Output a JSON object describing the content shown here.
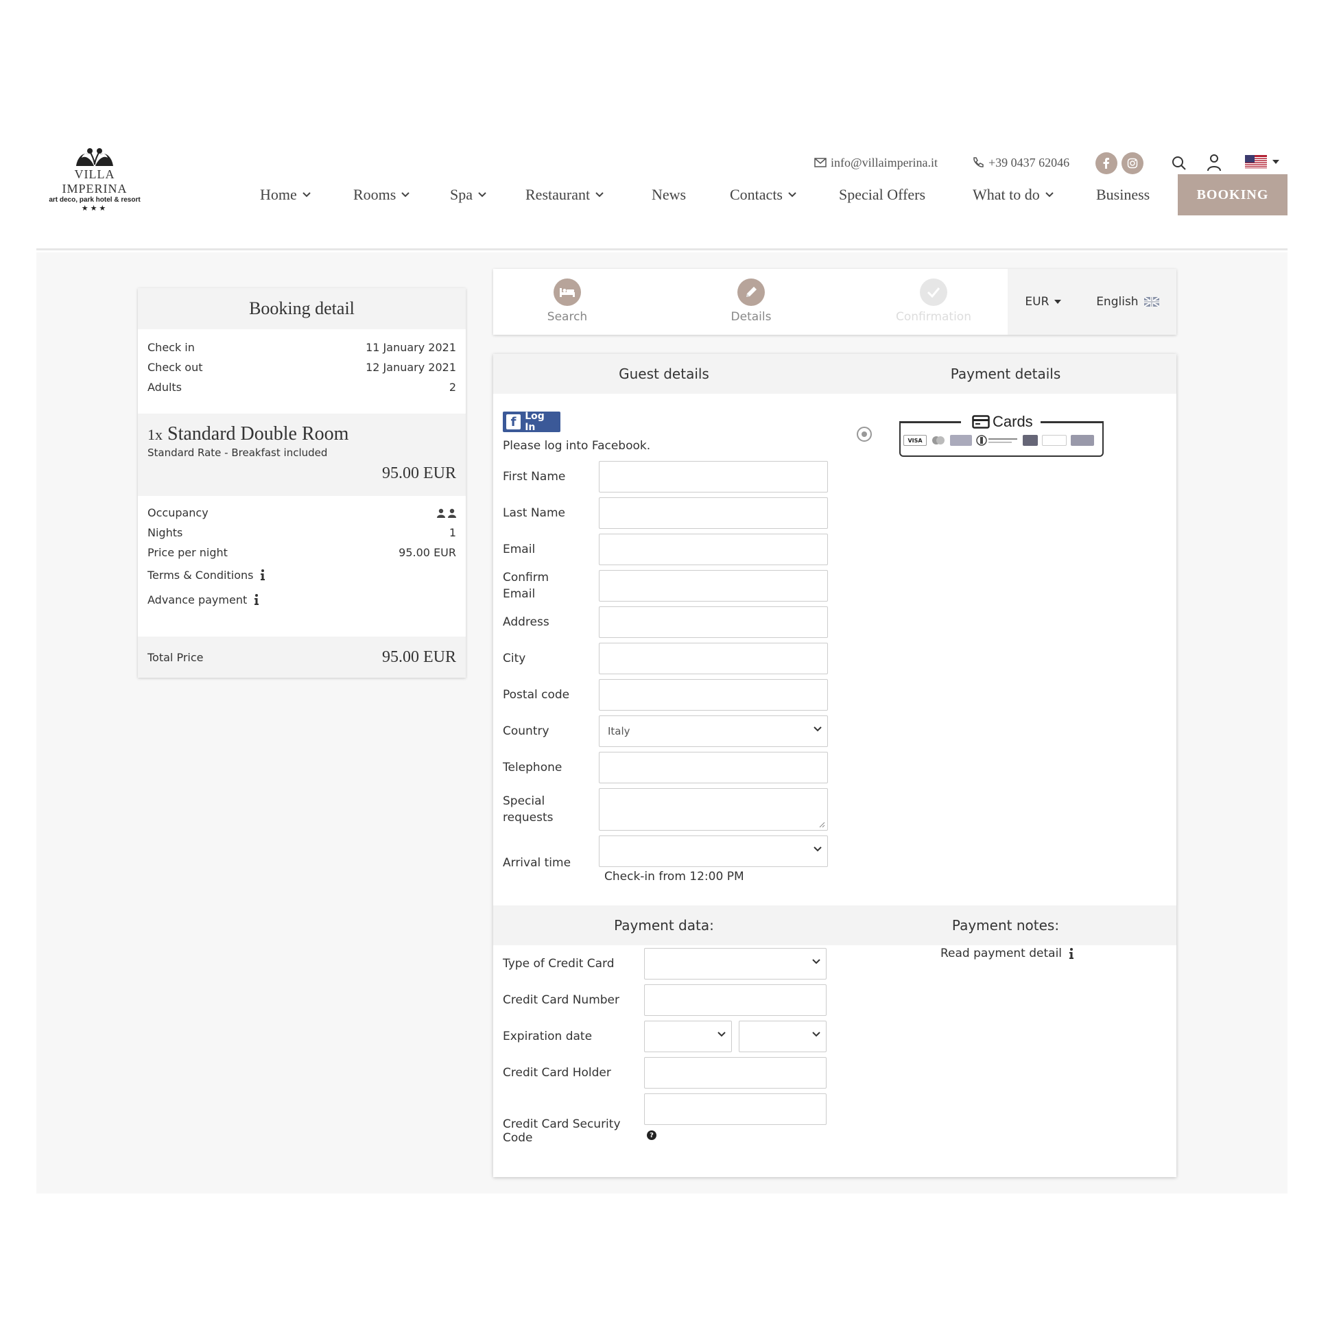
{
  "brand": {
    "name": "VILLA IMPERINA",
    "tagline": "art deco, park hotel & resort",
    "stars": "★★★"
  },
  "topbar": {
    "email": "info@villaimperina.it",
    "phone": "+39 0437 62046"
  },
  "nav": {
    "items": [
      {
        "label": "Home",
        "has_dropdown": true
      },
      {
        "label": "Rooms",
        "has_dropdown": true
      },
      {
        "label": "Spa",
        "has_dropdown": true
      },
      {
        "label": "Restaurant",
        "has_dropdown": true
      },
      {
        "label": "News",
        "has_dropdown": false
      },
      {
        "label": "Contacts",
        "has_dropdown": true
      },
      {
        "label": "Special Offers",
        "has_dropdown": false
      },
      {
        "label": "What to do",
        "has_dropdown": true
      },
      {
        "label": "Business",
        "has_dropdown": false
      }
    ],
    "booking_label": "BOOKING"
  },
  "booking_detail": {
    "title": "Booking detail",
    "rows": [
      {
        "label": "Check in",
        "value": "11 January 2021"
      },
      {
        "label": "Check out",
        "value": "12 January 2021"
      },
      {
        "label": "Adults",
        "value": "2"
      }
    ],
    "room": {
      "qty": "1x",
      "name": "Standard Double Room",
      "rate": "Standard Rate - Breakfast included",
      "price": "95.00 EUR"
    },
    "details": [
      {
        "label": "Occupancy",
        "value": ""
      },
      {
        "label": "Nights",
        "value": "1"
      },
      {
        "label": "Price per night",
        "value": "95.00 EUR"
      }
    ],
    "terms_label": "Terms & Conditions",
    "advance_label": "Advance payment",
    "total_label": "Total Price",
    "total_value": "95.00 EUR"
  },
  "steps": {
    "items": [
      {
        "label": "Search",
        "state": "done"
      },
      {
        "label": "Details",
        "state": "active"
      },
      {
        "label": "Confirmation",
        "state": "disabled"
      }
    ],
    "currency": "EUR",
    "language": "English"
  },
  "guest": {
    "header": "Guest details",
    "fb_login": "Log In",
    "fb_note": "Please log into Facebook.",
    "fields": {
      "first_name": "First Name",
      "last_name": "Last Name",
      "email": "Email",
      "confirm_email": "Confirm Email",
      "address": "Address",
      "city": "City",
      "postal": "Postal code",
      "country": "Country",
      "country_value": "Italy",
      "telephone": "Telephone",
      "special": "Special requests",
      "arrival": "Arrival time"
    },
    "checkin_note": "Check-in from 12:00 PM"
  },
  "payment": {
    "header": "Payment details",
    "cards_title": "Cards",
    "data_header": "Payment data:",
    "notes_header": "Payment notes:",
    "fields": {
      "type": "Type of Credit Card",
      "number": "Credit Card Number",
      "expiry": "Expiration date",
      "holder": "Credit Card Holder",
      "cvc": "Credit Card Security Code"
    },
    "read_detail": "Read payment detail"
  },
  "colors": {
    "accent": "#b7a49a",
    "facebook": "#3b5998"
  }
}
